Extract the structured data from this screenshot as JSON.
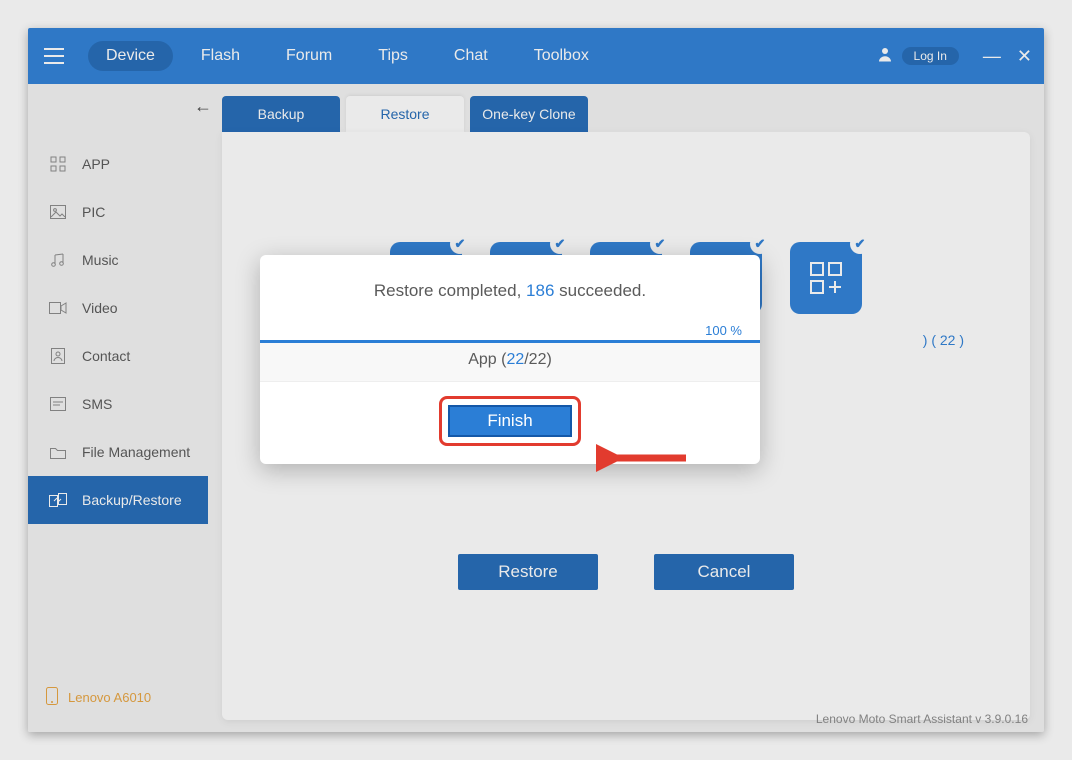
{
  "nav": {
    "items": [
      "Device",
      "Flash",
      "Forum",
      "Tips",
      "Chat",
      "Toolbox"
    ],
    "active": 0,
    "login": "Log In"
  },
  "sidebar": {
    "items": [
      {
        "label": "APP"
      },
      {
        "label": "PIC"
      },
      {
        "label": "Music"
      },
      {
        "label": "Video"
      },
      {
        "label": "Contact"
      },
      {
        "label": "SMS"
      },
      {
        "label": "File Management"
      },
      {
        "label": "Backup/Restore"
      }
    ],
    "active": 7,
    "device": "Lenovo A6010"
  },
  "tabs": {
    "items": [
      "Backup",
      "Restore",
      "One-key Clone"
    ],
    "active": 1
  },
  "tile": {
    "app_count_label": "( 22 )",
    "app_prefix": ")"
  },
  "panel": {
    "restore": "Restore",
    "cancel": "Cancel"
  },
  "modal": {
    "msg_prefix": "Restore completed, ",
    "succeeded_count": "186",
    "msg_suffix": " succeeded.",
    "progress_pct": "100 %",
    "category_prefix": "App (",
    "category_current": "22",
    "category_suffix": "/22)",
    "finish": "Finish"
  },
  "footer": "Lenovo Moto Smart Assistant v 3.9.0.16"
}
